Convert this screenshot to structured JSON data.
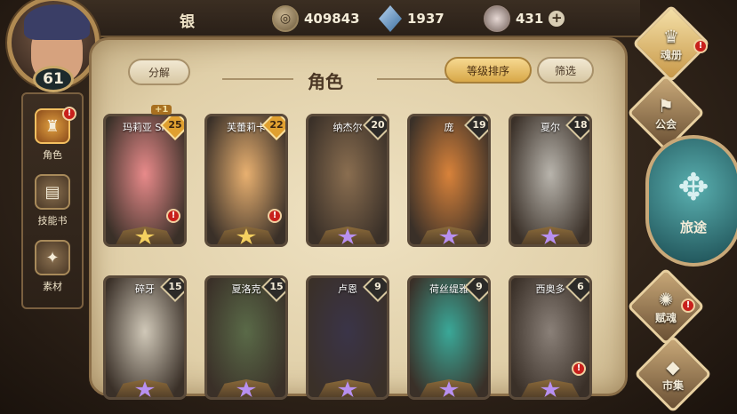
{
  "player": {
    "name": "银",
    "level": "61"
  },
  "resources": {
    "coins": "409843",
    "gems": "1937",
    "crystals": "431"
  },
  "left_nav": [
    {
      "label": "角色",
      "icon": "helmet-icon",
      "alert": true
    },
    {
      "label": "技能书",
      "icon": "book-icon",
      "alert": false
    },
    {
      "label": "素材",
      "icon": "claw-icon",
      "alert": false
    }
  ],
  "toolbar": {
    "decompose": "分解",
    "sort": "等级排序",
    "filter": "筛选"
  },
  "section_title": "角色",
  "badge_plus": "+1",
  "characters": [
    {
      "name": "玛莉亚 SP",
      "level": "25",
      "rarity": "gold",
      "alert": true,
      "color": "#e88a8a"
    },
    {
      "name": "芙蕾莉卡",
      "level": "22",
      "rarity": "gold",
      "alert": true,
      "color": "#e8b070"
    },
    {
      "name": "纳杰尔",
      "level": "20",
      "rarity": "purple",
      "alert": false,
      "color": "#8a6e50"
    },
    {
      "name": "庞",
      "level": "19",
      "rarity": "purple",
      "alert": false,
      "color": "#d8823a"
    },
    {
      "name": "夏尔",
      "level": "18",
      "rarity": "purple",
      "alert": false,
      "color": "#b8b4ac"
    },
    {
      "name": "碎牙",
      "level": "15",
      "rarity": "purple",
      "alert": false,
      "color": "#d0c8b8"
    },
    {
      "name": "夏洛克",
      "level": "15",
      "rarity": "purple",
      "alert": false,
      "color": "#5a6a48"
    },
    {
      "name": "卢恩",
      "level": "9",
      "rarity": "purple",
      "alert": false,
      "color": "#3a3448"
    },
    {
      "name": "荷丝缇雅",
      "level": "9",
      "rarity": "purple",
      "alert": false,
      "color": "#3aa898"
    },
    {
      "name": "西奥多",
      "level": "6",
      "rarity": "purple",
      "alert": true,
      "color": "#8a8078"
    }
  ],
  "right_nav": [
    {
      "label": "魂册",
      "icon": "soul-icon",
      "alert": true
    },
    {
      "label": "公会",
      "icon": "guild-icon",
      "alert": false
    },
    {
      "label": "旅途",
      "icon": "compass-icon",
      "alert": false
    },
    {
      "label": "赋魂",
      "icon": "flame-icon",
      "alert": true
    },
    {
      "label": "市集",
      "icon": "market-icon",
      "alert": false
    }
  ],
  "alert_mark": "!"
}
